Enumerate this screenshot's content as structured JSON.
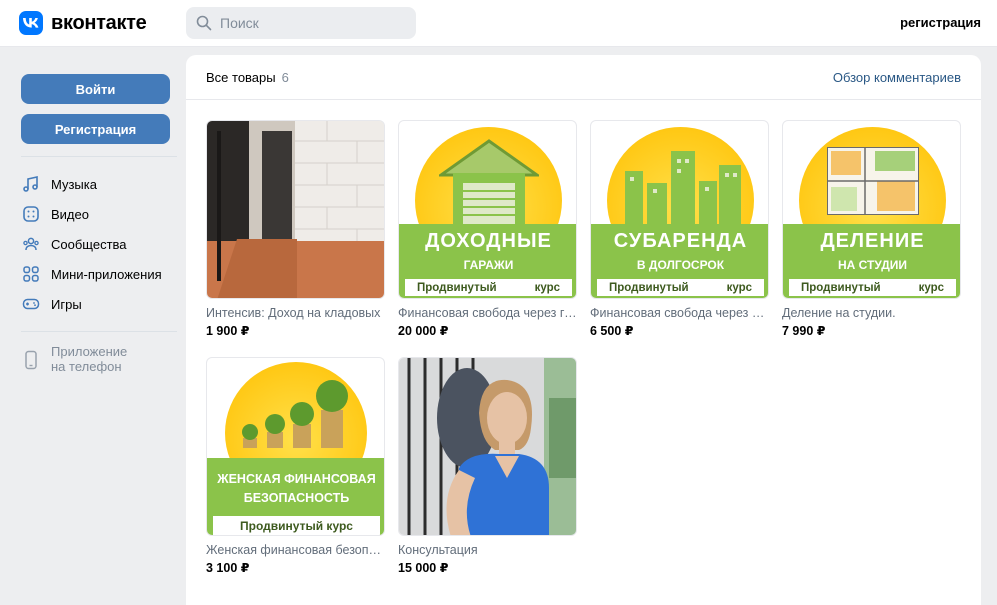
{
  "header": {
    "brand": "вконтакте",
    "search_placeholder": "Поиск",
    "register_link": "регистрация"
  },
  "sidebar": {
    "login_label": "Войти",
    "signup_label": "Регистрация",
    "items": [
      {
        "label": "Музыка",
        "icon": "music-icon"
      },
      {
        "label": "Видео",
        "icon": "video-icon"
      },
      {
        "label": "Сообщества",
        "icon": "communities-icon"
      },
      {
        "label": "Мини-приложения",
        "icon": "mini-apps-icon"
      },
      {
        "label": "Игры",
        "icon": "gamepad-icon"
      }
    ],
    "app": {
      "line1": "Приложение",
      "line2": "на телефон",
      "icon": "phone-icon"
    }
  },
  "main": {
    "title": "Все товары",
    "count": "6",
    "reviews_link": "Обзор комментариев",
    "products": [
      {
        "name": "Интенсив: Доход на кладовых",
        "price": "1 900 ₽"
      },
      {
        "name": "Финансовая свобода через гаражи",
        "price": "20 000 ₽",
        "banner_big": "ДОХОДНЫЕ",
        "banner_small": "ГАРАЖИ",
        "course_a": "Продвинутый",
        "course_b": "курс"
      },
      {
        "name": "Финансовая свобода через субаренду",
        "price": "6 500 ₽",
        "banner_big": "СУБАРЕНДА",
        "banner_small": "В ДОЛГОСРОК",
        "course_a": "Продвинутый",
        "course_b": "курс"
      },
      {
        "name": "Деление на студии.",
        "price": "7 990 ₽",
        "banner_big": "ДЕЛЕНИЕ",
        "banner_small": "НА СТУДИИ",
        "course_a": "Продвинутый",
        "course_b": "курс"
      },
      {
        "name": "Женская финансовая безопасность",
        "price": "3 100 ₽",
        "banner_line1": "ЖЕНСКАЯ ФИНАНСОВАЯ",
        "banner_line2": "БЕЗОПАСНОСТЬ",
        "course": "Продвинутый курс"
      },
      {
        "name": "Консультация",
        "price": "15 000 ₽"
      }
    ]
  },
  "colors": {
    "accent": "#447bba",
    "brand": "#0077ff",
    "banner_green": "#8bc34a",
    "sun_yellow": "#ffc800"
  }
}
